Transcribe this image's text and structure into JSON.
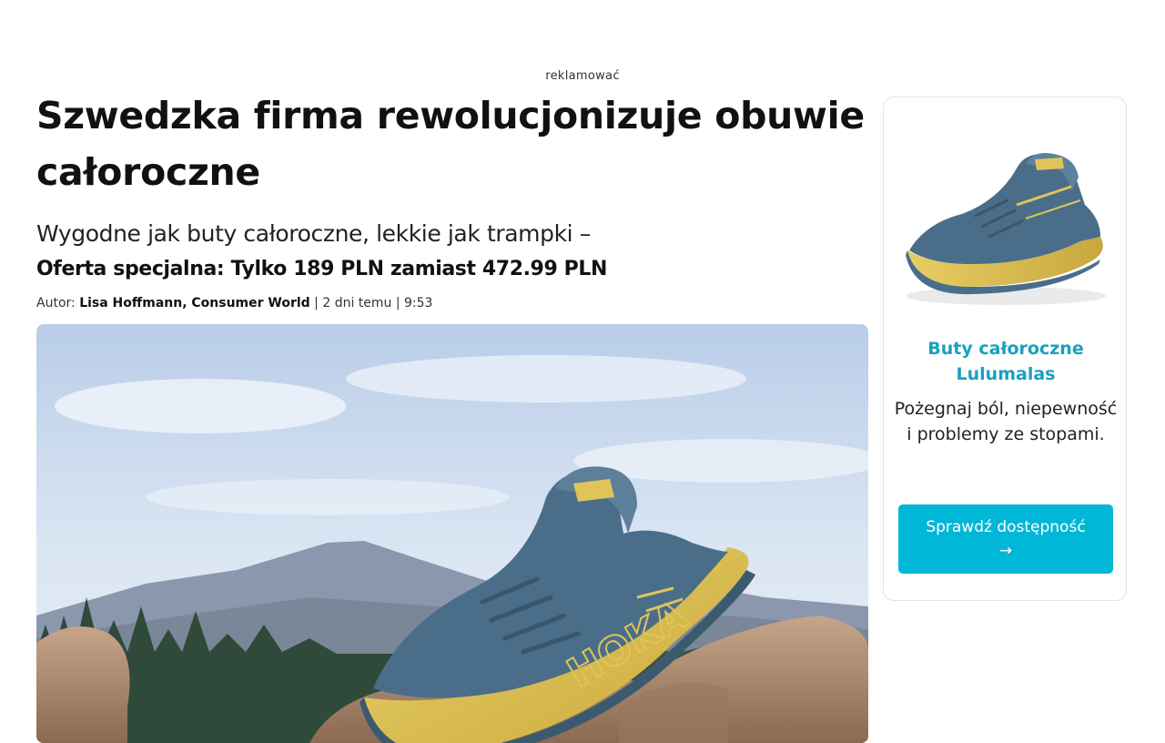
{
  "ad_label": "reklamować",
  "article": {
    "title_line1": "Szwedzka firma rewolucjonizuje obuwie",
    "title_line2": "całoroczne",
    "subtitle": "Wygodne jak buty całoroczne, lekkie jak trampki –",
    "offer": "Oferta specjalna: Tylko 189 PLN zamiast 472.99 PLN",
    "byline": {
      "prefix": "Autor: ",
      "author": "Lisa Hoffmann, Consumer World",
      "meta": " | 2 dni temu | 9:53"
    },
    "hero_image": "hoka-running-shoe-on-rock-mountain-scene",
    "shoe_brand_text": "HOKA"
  },
  "sidebar": {
    "product_image": "blue-yellow-running-shoe",
    "title": "Buty całoroczne Lulumalas",
    "text": "Pożegnaj ból, niepewność i problemy ze stopami.",
    "button_label": "Sprawdź dostępność",
    "button_arrow": "→"
  },
  "colors": {
    "accent_teal": "#1aa0bf",
    "button_bg": "#00b7d8",
    "shoe_blue": "#4a6e8a",
    "shoe_yellow": "#e0c45a"
  }
}
